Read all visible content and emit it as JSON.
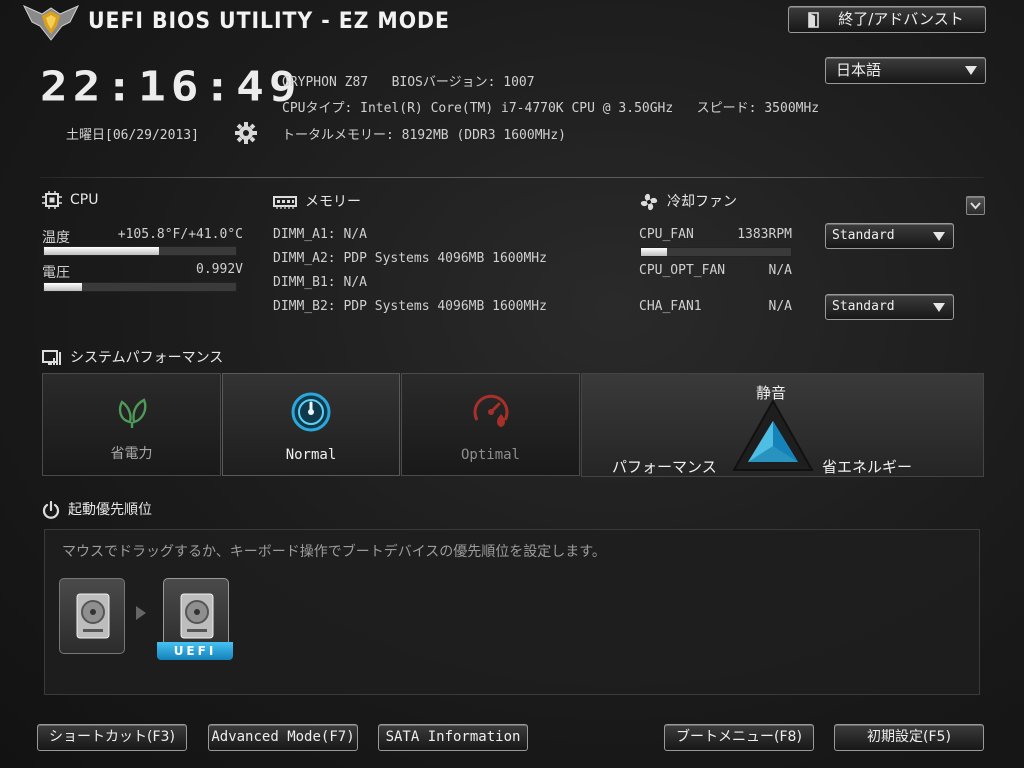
{
  "header": {
    "title": "UEFI BIOS UTILITY - EZ MODE",
    "exit_label": "終了/アドバンスト",
    "language": "日本語"
  },
  "clock": {
    "time": "22:16:49",
    "date": "土曜日[06/29/2013]"
  },
  "system_info": {
    "line1": "GRYPHON Z87   BIOSバージョン: 1007",
    "line2": "CPUタイプ: Intel(R) Core(TM) i7-4770K CPU @ 3.50GHz   スピード: 3500MHz",
    "line3": "トータルメモリー: 8192MB (DDR3 1600MHz)"
  },
  "cpu": {
    "title": "CPU",
    "temp_label": "温度",
    "temp_value": "+105.8°F/+41.0°C",
    "temp_level": 0.6,
    "voltage_label": "電圧",
    "voltage_value": "0.992V",
    "voltage_level": 0.2
  },
  "memory": {
    "title": "メモリー",
    "slots": [
      "DIMM_A1: N/A",
      "DIMM_A2: PDP Systems 4096MB 1600MHz",
      "DIMM_B1: N/A",
      "DIMM_B2: PDP Systems 4096MB 1600MHz"
    ]
  },
  "fans": {
    "title": "冷却ファン",
    "items": [
      {
        "name": "CPU_FAN",
        "value": "1383RPM",
        "mode": "Standard",
        "level": 0.17
      },
      {
        "name": "CPU_OPT_FAN",
        "value": "N/A"
      },
      {
        "name": "CHA_FAN1",
        "value": "N/A",
        "mode": "Standard"
      }
    ]
  },
  "performance": {
    "title": "システムパフォーマンス",
    "modes": [
      "省電力",
      "Normal",
      "Optimal"
    ],
    "selected": "Normal",
    "triangle": {
      "top": "静音",
      "left": "パフォーマンス",
      "right": "省エネルギー"
    }
  },
  "boot": {
    "title": "起動優先順位",
    "hint": "マウスでドラッグするか、キーボード操作でブートデバイスの優先順位を設定します。",
    "uefi_badge": "UEFI"
  },
  "footer": {
    "shortcut": "ショートカット(F3)",
    "advanced": "Advanced Mode(F7)",
    "sata": "SATA Information",
    "boot_menu": "ブートメニュー(F8)",
    "defaults": "初期設定(F5)"
  },
  "colors": {
    "accent": "#2aa8dc",
    "optimal": "#a8302a",
    "eco": "#4e9a57"
  }
}
